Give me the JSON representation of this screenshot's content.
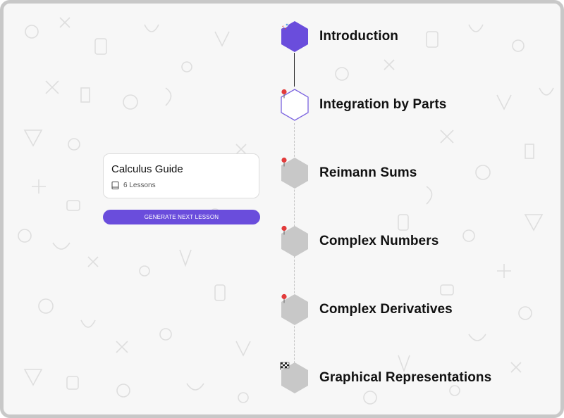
{
  "course": {
    "title": "Calculus Guide",
    "lessons_label": "6 Lessons"
  },
  "actions": {
    "generate_label": "GENERATE NEXT LESSON"
  },
  "timeline": {
    "steps": [
      {
        "label": "Introduction",
        "icon": "rocket-icon",
        "state": "completed"
      },
      {
        "label": "Integration by Parts",
        "icon": "pin-icon",
        "state": "current"
      },
      {
        "label": "Reimann Sums",
        "icon": "pin-icon",
        "state": "locked"
      },
      {
        "label": "Complex Numbers",
        "icon": "pin-icon",
        "state": "locked"
      },
      {
        "label": "Complex Derivatives",
        "icon": "pin-icon",
        "state": "locked"
      },
      {
        "label": "Graphical Representations",
        "icon": "checkered-flag-icon",
        "state": "locked"
      }
    ]
  },
  "colors": {
    "accent": "#6a4ddc",
    "locked": "#c8c8c8",
    "pin": "#e23b3b"
  }
}
